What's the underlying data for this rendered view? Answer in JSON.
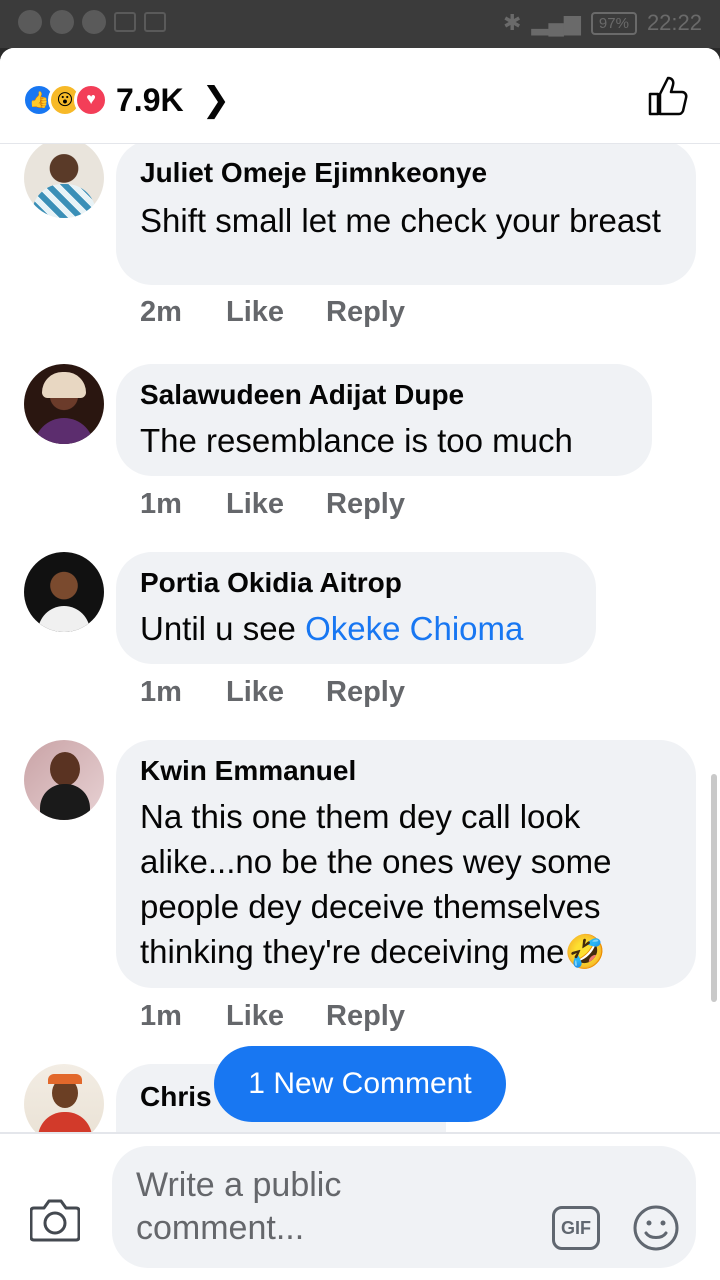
{
  "status_bar": {
    "battery": "97%",
    "time": "22:22"
  },
  "header": {
    "reaction_count": "7.9K"
  },
  "comments": [
    {
      "name": "Juliet Omeje Ejimnkeonye",
      "text": " Shift small let me check your breast",
      "time": "2m",
      "like": "Like",
      "reply": "Reply"
    },
    {
      "name": "Salawudeen Adijat Dupe",
      "text": "The resemblance is too much",
      "time": "1m",
      "like": "Like",
      "reply": "Reply"
    },
    {
      "name": "Portia Okidia Aitrop",
      "text_prefix": "Until u see ",
      "mention": "Okeke Chioma",
      "time": "1m",
      "like": "Like",
      "reply": "Reply"
    },
    {
      "name": "Kwin Emmanuel",
      "text": "Na this one them dey call look alike...no be the ones wey some people dey deceive themselves thinking they're deceiving me🤣",
      "time": "1m",
      "like": "Like",
      "reply": "Reply"
    },
    {
      "name": "Chris"
    }
  ],
  "new_comment_pill": "1 New Comment",
  "composer": {
    "placeholder": "Write a public comment...",
    "gif_label": "GIF"
  },
  "colors": {
    "accent": "#1877f2",
    "bubble": "#f0f2f5",
    "muted": "#65676b"
  }
}
